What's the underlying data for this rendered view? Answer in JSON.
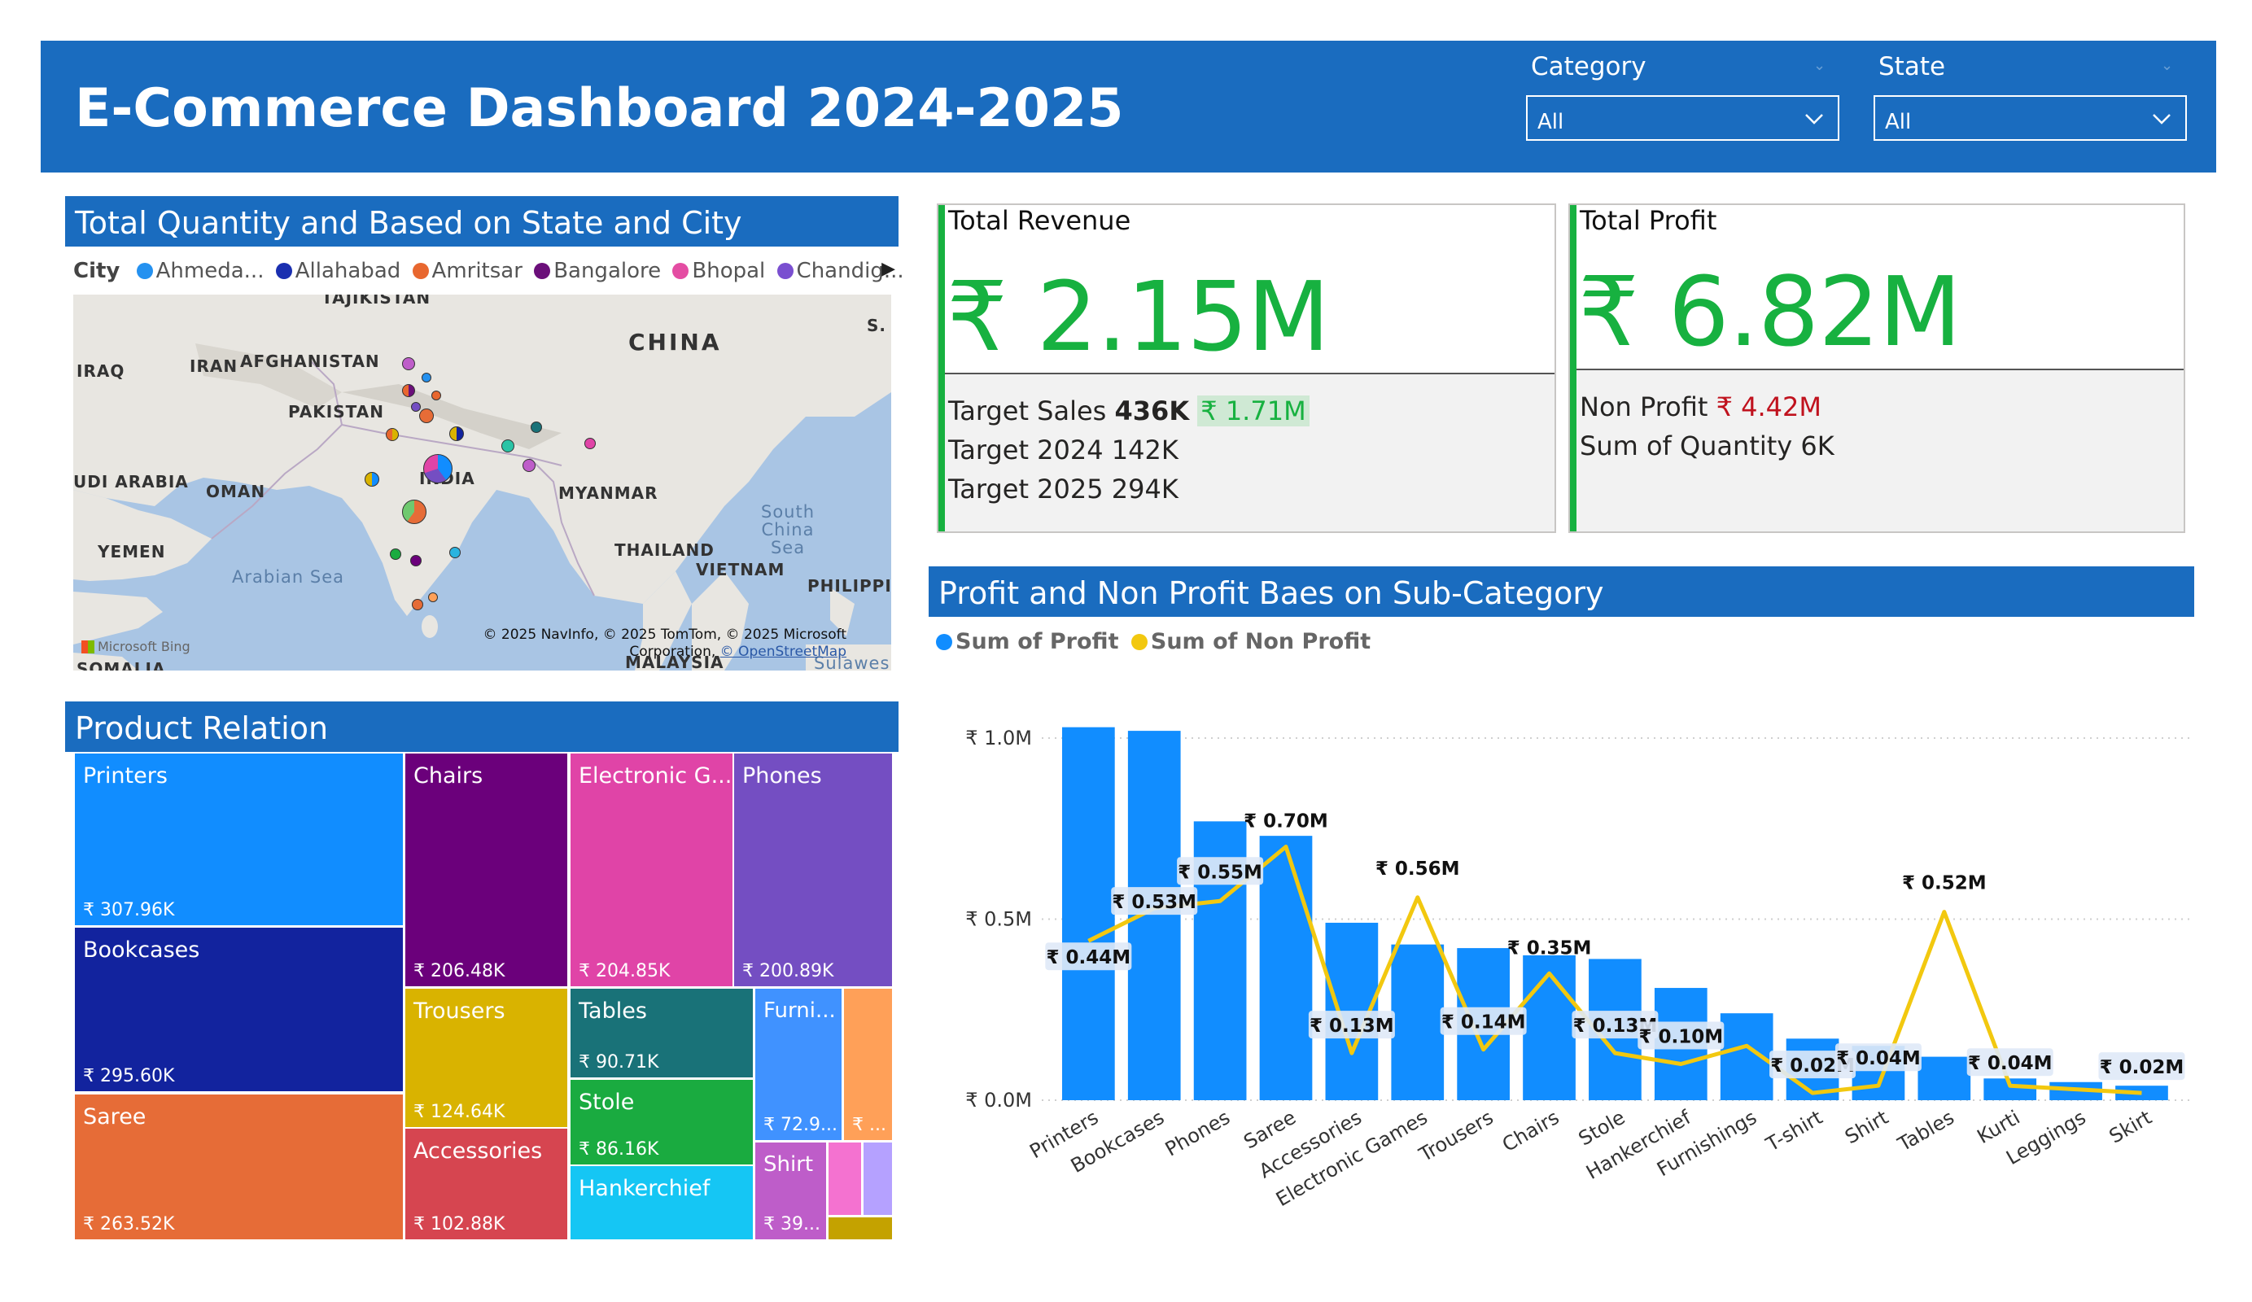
{
  "header": {
    "title": "E-Commerce Dashboard 2024-2025",
    "slicers": [
      {
        "label": "Category",
        "value": "All"
      },
      {
        "label": "State",
        "value": "All"
      }
    ]
  },
  "map_section": {
    "title": "Total Quantity and Based on State and City",
    "legend_title": "City",
    "legend": [
      {
        "name": "Ahmeda...",
        "color": "#2491f0"
      },
      {
        "name": "Allahabad",
        "color": "#1a2fb0"
      },
      {
        "name": "Amritsar",
        "color": "#e8672f"
      },
      {
        "name": "Bangalore",
        "color": "#6b0f7a"
      },
      {
        "name": "Bhopal",
        "color": "#e44da3"
      },
      {
        "name": "Chandig...",
        "color": "#7a4fd0"
      }
    ],
    "labels": {
      "tajikistan": "TAJIKISTAN",
      "iraq": "IRAQ",
      "iran": "IRAN",
      "afghanistan": "AFGHANISTAN",
      "china": "CHINA",
      "s": "S.",
      "pakistan": "PAKISTAN",
      "saudi": "UDI ARABIA",
      "oman": "OMAN",
      "india": "INDIA",
      "myanmar": "MYANMAR",
      "south_china_sea": "South China Sea",
      "yemen": "YEMEN",
      "thailand": "THAILAND",
      "arabian_sea": "Arabian Sea",
      "vietnam": "VIETNAM",
      "philippines": "PHILIPPI",
      "somalia": "SOMALIA",
      "malaysia": "MALAYSIA",
      "sulawesi": "Sulawesi"
    },
    "bing": "Microsoft Bing",
    "copyright_line1": "© 2025 NavInfo, © 2025 TomTom, © 2025 Microsoft",
    "copyright_line2a": "Corporation,",
    "copyright_line2b": "© OpenStreetMap"
  },
  "treemap": {
    "title": "Product Relation",
    "tiles": [
      {
        "name": "Printers",
        "value": "₹ 307.96K",
        "color": "#118dff"
      },
      {
        "name": "Bookcases",
        "value": "₹ 295.60K",
        "color": "#12239e"
      },
      {
        "name": "Saree",
        "value": "₹ 263.52K",
        "color": "#e66c37"
      },
      {
        "name": "Chairs",
        "value": "₹ 206.48K",
        "color": "#6b007b"
      },
      {
        "name": "Electronic G...",
        "value": "₹ 204.85K",
        "color": "#e044a7"
      },
      {
        "name": "Phones",
        "value": "₹ 200.89K",
        "color": "#744ec2"
      },
      {
        "name": "Trousers",
        "value": "₹ 124.64K",
        "color": "#d9b300"
      },
      {
        "name": "Accessories",
        "value": "₹ 102.88K",
        "color": "#d64550"
      },
      {
        "name": "Tables",
        "value": "₹ 90.71K",
        "color": "#197278"
      },
      {
        "name": "Stole",
        "value": "₹ 86.16K",
        "color": "#1aab40"
      },
      {
        "name": "Hankerchief",
        "value": "",
        "color": "#15c6f4"
      },
      {
        "name": "Furni...",
        "value": "₹ 72.9...",
        "color": "#4092ff"
      },
      {
        "name": "",
        "value": "₹ ...",
        "color": "#ffa058"
      },
      {
        "name": "Shirt",
        "value": "₹ 39...",
        "color": "#be5dc9"
      },
      {
        "name": "",
        "value": "",
        "color": "#f472d0"
      },
      {
        "name": "",
        "value": "",
        "color": "#b5a1ff"
      },
      {
        "name": "",
        "value": "",
        "color": "#c4a200"
      }
    ]
  },
  "kpi": {
    "revenue": {
      "title": "Total Revenue",
      "value": "₹ 2.15M",
      "target_sales_label": "Target Sales",
      "target_sales_value": "436K",
      "target_sales_diff": "₹ 1.71M",
      "target_2024": "Target 2024 142K",
      "target_2025": "Target 2025 294K"
    },
    "profit": {
      "title": "Total Profit",
      "value": "₹ 6.82M",
      "non_profit_label": "Non Profit",
      "non_profit_value": "₹ 4.42M",
      "quantity": "Sum of Quantity 6K"
    }
  },
  "bar_section": {
    "title": "Profit and Non Profit Baes on Sub-Category",
    "legend": [
      {
        "name": "Sum of Profit",
        "color": "#118dff"
      },
      {
        "name": "Sum of Non Profit",
        "color": "#f2c80f"
      }
    ]
  },
  "chart_data": {
    "type": "bar",
    "categories": [
      "Printers",
      "Bookcases",
      "Phones",
      "Saree",
      "Accessories",
      "Electronic Games",
      "Trousers",
      "Chairs",
      "Stole",
      "Hankerchief",
      "Furnishings",
      "T-shirt",
      "Shirt",
      "Tables",
      "Kurti",
      "Leggings",
      "Skirt"
    ],
    "series": [
      {
        "name": "Sum of Profit",
        "type": "bar",
        "color": "#118dff",
        "values": [
          1.03,
          1.02,
          0.77,
          0.73,
          0.49,
          0.43,
          0.42,
          0.4,
          0.39,
          0.31,
          0.24,
          0.17,
          0.15,
          0.12,
          0.06,
          0.05,
          0.04
        ]
      },
      {
        "name": "Sum of Non Profit",
        "type": "line",
        "color": "#f2c80f",
        "values": [
          0.44,
          0.53,
          0.55,
          0.7,
          0.13,
          0.56,
          0.14,
          0.35,
          0.13,
          0.1,
          0.15,
          0.02,
          0.04,
          0.52,
          0.04,
          0.03,
          0.02
        ],
        "labels": [
          "₹ 0.44M",
          "₹ 0.53M",
          "₹ 0.55M",
          "₹ 0.70M",
          "₹ 0.13M",
          "₹ 0.56M",
          "₹ 0.14M",
          "₹ 0.35M",
          "₹ 0.13M",
          "₹ 0.10M",
          "",
          "₹ 0.02M",
          "₹ 0.04M",
          "₹ 0.52M",
          "₹ 0.04M",
          "",
          "₹ 0.02M"
        ]
      }
    ],
    "yticks": [
      "₹ 0.0M",
      "₹ 0.5M",
      "₹ 1.0M"
    ],
    "ylim": [
      0,
      1.0
    ],
    "xlabel": "",
    "ylabel": "",
    "grid": true
  }
}
